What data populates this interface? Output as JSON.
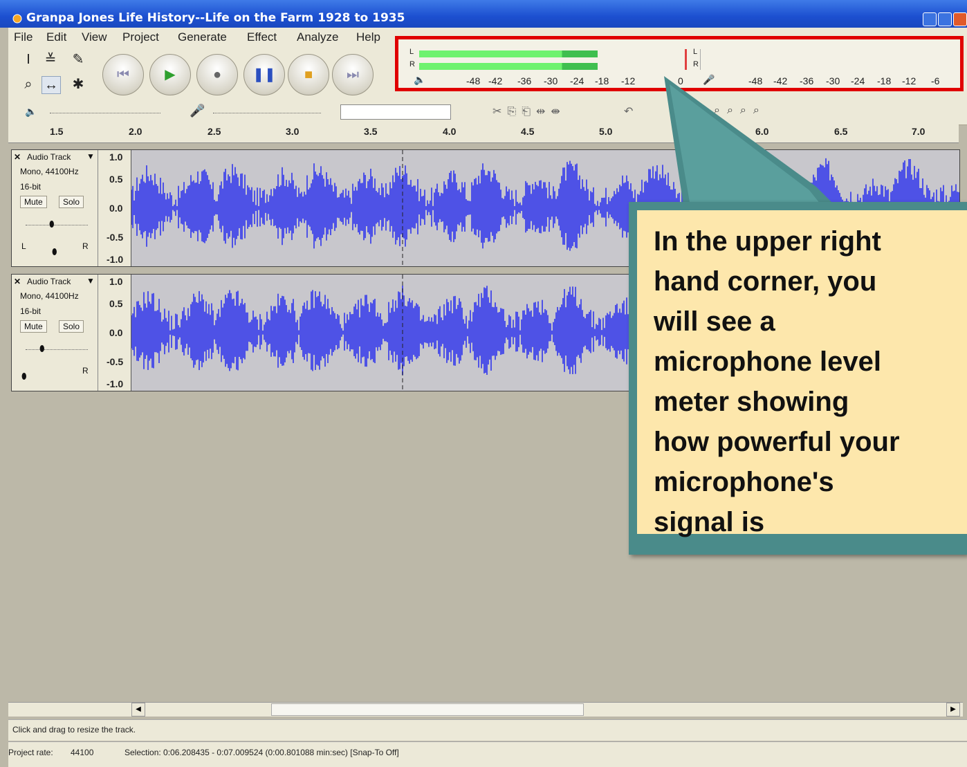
{
  "window": {
    "title": "Granpa Jones Life History--Life on the Farm 1928 to 1935"
  },
  "menu": [
    "File",
    "Edit",
    "View",
    "Project",
    "Generate",
    "Effect",
    "Analyze",
    "Help"
  ],
  "meter": {
    "left_label": "L",
    "right_label": "R",
    "playback_ticks": [
      "-48",
      "-42",
      "-36",
      "-30",
      "-24",
      "-18",
      "-12",
      "0"
    ],
    "record_ticks": [
      "-48",
      "-42",
      "-36",
      "-30",
      "-24",
      "-18",
      "-12",
      "-6"
    ],
    "left_level_fraction": 0.68,
    "right_level_fraction": 0.68
  },
  "ruler": {
    "ticks": [
      "1.5",
      "2.0",
      "2.5",
      "3.0",
      "3.5",
      "4.0",
      "4.5",
      "5.0",
      "6.0",
      "6.5",
      "7.0"
    ]
  },
  "tracks": [
    {
      "name": "Audio Track",
      "info1": "Mono, 44100Hz",
      "info2": "16-bit",
      "mute": "Mute",
      "solo": "Solo",
      "scale": [
        "1.0",
        "0.5",
        "0.0",
        "-0.5",
        "-1.0"
      ],
      "pan_L": "L",
      "pan_R": "R"
    },
    {
      "name": "Audio Track",
      "info1": "Mono, 44100Hz",
      "info2": "16-bit",
      "mute": "Mute",
      "solo": "Solo",
      "scale": [
        "1.0",
        "0.5",
        "0.0",
        "-0.5",
        "-1.0"
      ],
      "pan_R": "R"
    }
  ],
  "status": {
    "hint": "Click and drag to resize the track.",
    "project_rate_label": "Project rate:",
    "project_rate_value": "44100",
    "selection": "Selection: 0:06.208435 - 0:07.009524 (0:00.801088 min:sec)  [Snap-To Off]"
  },
  "callout": {
    "text": "In the upper right\nhand corner, you\nwill see a\nmicrophone level\nmeter showing\nhow powerful your\nmicrophone's\nsignal is"
  },
  "colors": {
    "titlebar": "#1c4fd0",
    "meter_green": "#5fe55f",
    "highlight_red": "#e00000",
    "waveform": "#4e52e6",
    "callout_bg": "#fde7ac",
    "callout_border": "#4a8b8a"
  }
}
